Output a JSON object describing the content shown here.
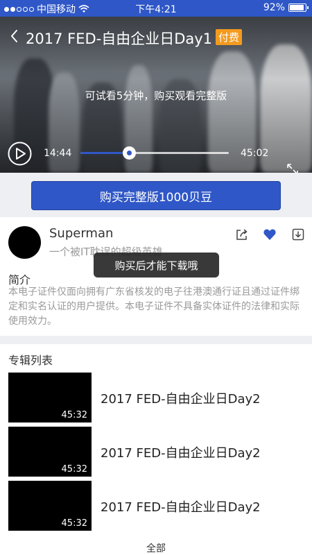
{
  "status_bar": {
    "carrier": "中国移动",
    "time": "下午4:21",
    "battery": "92%",
    "battery_level": 0.92
  },
  "video": {
    "title": "2017 FED-自由企业日Day1",
    "paid_badge": "付费",
    "trial_text": "可试看5分钟，购买观看完整版",
    "current_time": "14:44",
    "total_time": "45:02",
    "progress": 0.327,
    "icons": {
      "back": "chevron-left-icon",
      "play": "play-icon",
      "fullscreen": "expand-icon"
    }
  },
  "buy": {
    "label": "购买完整版1000贝豆"
  },
  "author": {
    "name": "Superman",
    "subtitle": "一个被IT耽误的超级英雄",
    "actions": [
      "share-icon",
      "heart-icon",
      "download-icon"
    ]
  },
  "toast": {
    "text": "购买后才能下载哦"
  },
  "intro": {
    "title": "简介",
    "text": "本电子证件仅面向拥有广东省核发的电子往港澳通行证且通过证件绑定和实名认证的用户提供。本电子证件不具备实体证件的法律和实际使用效力。"
  },
  "album": {
    "title": "专辑列表",
    "items": [
      {
        "name": "2017 FED-自由企业日Day2",
        "duration": "45:32"
      },
      {
        "name": "2017 FED-自由企业日Day2",
        "duration": "45:32"
      },
      {
        "name": "2017 FED-自由企业日Day2",
        "duration": "45:32"
      }
    ],
    "view_all": "全部"
  },
  "colors": {
    "accent": "#2f57c7",
    "badge": "#f39a1e",
    "section_bg": "#eeeff3"
  }
}
